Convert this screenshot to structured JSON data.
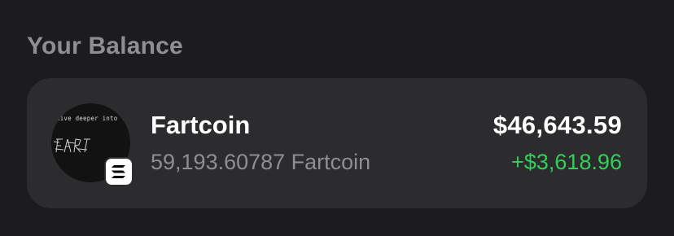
{
  "section": {
    "title": "Your Balance"
  },
  "balance_item": {
    "token_name": "Fartcoin",
    "token_amount": "59,193.60787 Fartcoin",
    "usd_value": "$46,643.59",
    "change": "+$3,618.96",
    "avatar_caption": "dive deeper into this",
    "avatar_icon": "fartcoin-logo-icon",
    "chain_icon": "solana-icon"
  },
  "colors": {
    "background": "#1c1c1e",
    "card": "#2c2c2e",
    "secondary_text": "#8e8e93",
    "positive": "#30d158",
    "primary_text": "#ffffff"
  }
}
